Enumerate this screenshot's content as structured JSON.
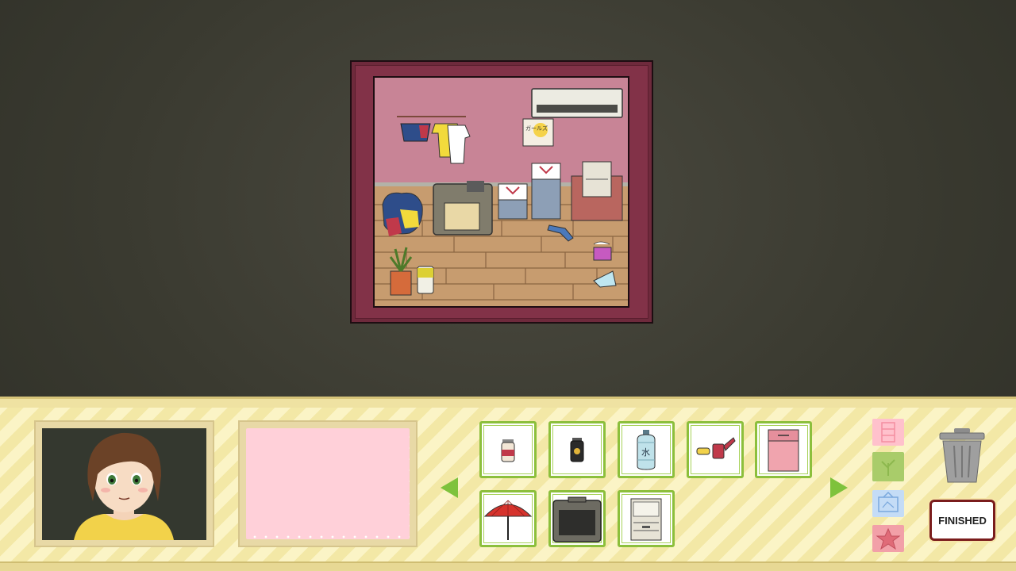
{
  "scene": {
    "poster_text": "ガールズ"
  },
  "inventory": {
    "items": [
      {
        "icon": "spice-jar-icon"
      },
      {
        "icon": "dark-canister-icon"
      },
      {
        "icon": "water-bottle-icon",
        "label": "水"
      },
      {
        "icon": "spray-can-icon"
      },
      {
        "icon": "pink-cabinet-icon"
      },
      {
        "icon": "red-parasol-icon"
      },
      {
        "icon": "crt-tv-icon"
      },
      {
        "icon": "grey-drawer-cabinet-icon"
      }
    ]
  },
  "categories": [
    {
      "icon": "cabinet-category-icon",
      "color": "#ffc1cc"
    },
    {
      "icon": "plant-category-icon",
      "color": "#a9cc6a"
    },
    {
      "icon": "picture-category-icon",
      "color": "#c4dcf6"
    },
    {
      "icon": "star-category-icon",
      "color": "#f2a0a8"
    }
  ],
  "actions": {
    "finished_label": "FINISHED"
  },
  "colors": {
    "accent_green": "#7ec23c",
    "finish_border": "#7a1c1c",
    "note_pink": "#ffd0d9"
  }
}
